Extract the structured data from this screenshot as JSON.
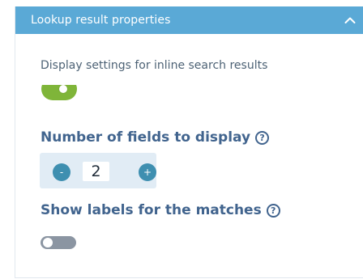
{
  "panel": {
    "title": "Lookup result properties",
    "collapse_icon": "chevron-up-icon"
  },
  "description": "Display settings for inline search results",
  "display_toggle": {
    "state": "on",
    "color": "#7fb539"
  },
  "fields_setting": {
    "label": "Number of fields to display",
    "help_icon": "help-circle-icon",
    "decrement_label": "-",
    "value": "2",
    "increment_label": "+"
  },
  "labels_setting": {
    "label": "Show labels for the matches",
    "help_icon": "help-circle-icon",
    "toggle_state": "off",
    "toggle_color": "#8b95a2"
  },
  "colors": {
    "header": "#5aa9d6",
    "heading_text": "#41648e",
    "stepper_bg": "#e1ecf5",
    "stepper_button": "#3e8fb0"
  }
}
